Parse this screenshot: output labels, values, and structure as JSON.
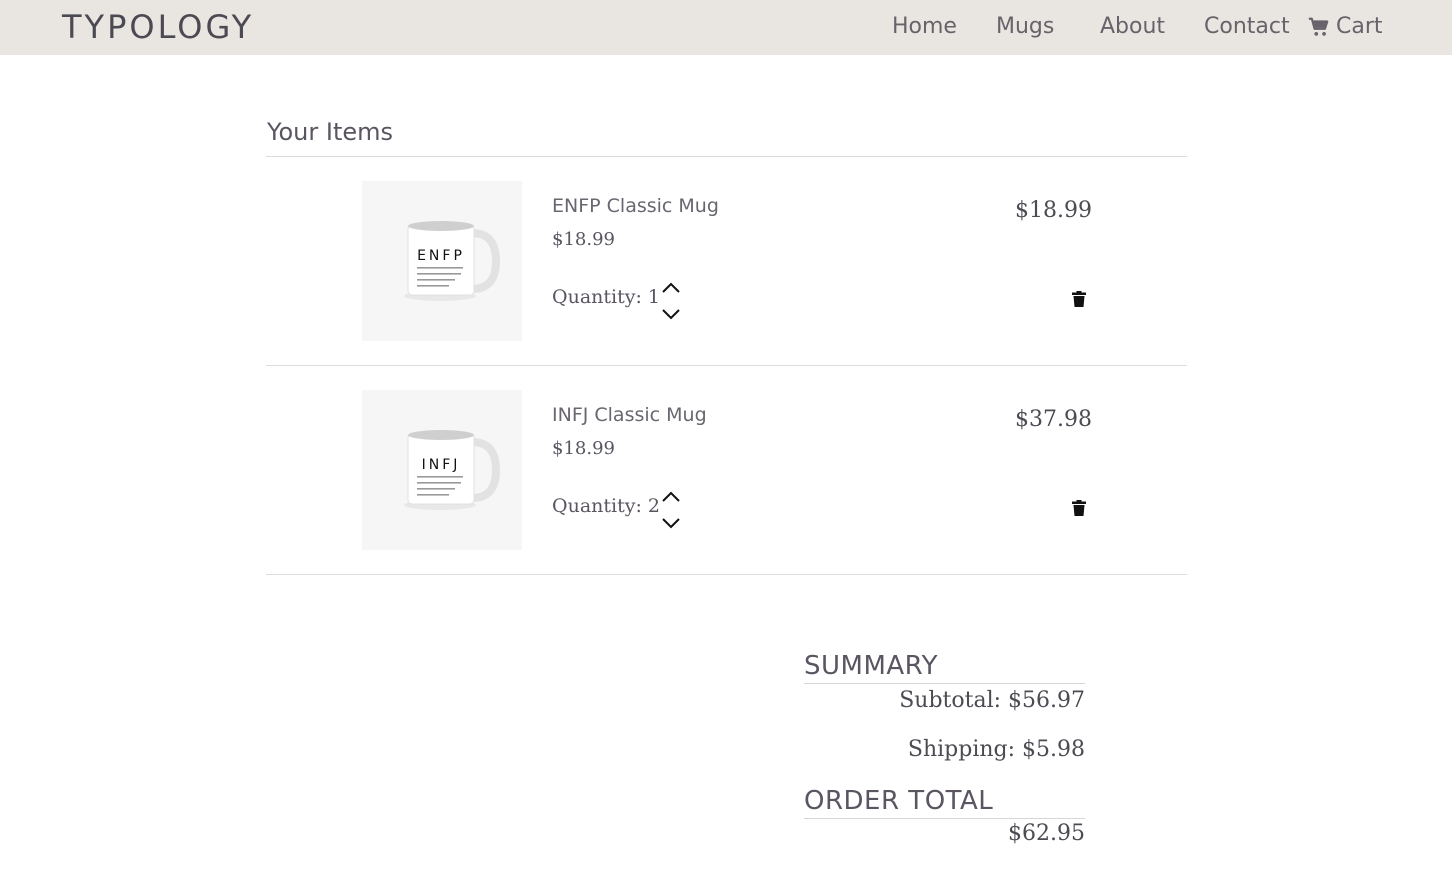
{
  "nav": {
    "brand": "TYPOLOGY",
    "links": [
      "Home",
      "Mugs",
      "About",
      "Contact"
    ],
    "cart_label": "Cart"
  },
  "cart": {
    "title": "Your Items",
    "quantity_label": "Quantity:",
    "items": [
      {
        "name": "ENFP Classic Mug",
        "unit_price": "$18.99",
        "quantity": "1",
        "line_total": "$18.99",
        "mug_text": "ENFP"
      },
      {
        "name": "INFJ Classic Mug",
        "unit_price": "$18.99",
        "quantity": "2",
        "line_total": "$37.98",
        "mug_text": "INFJ"
      }
    ]
  },
  "summary": {
    "heading": "SUMMARY",
    "subtotal": "Subtotal: $56.97",
    "shipping": "Shipping: $5.98",
    "total_heading": "ORDER TOTAL",
    "total": "$62.95"
  }
}
